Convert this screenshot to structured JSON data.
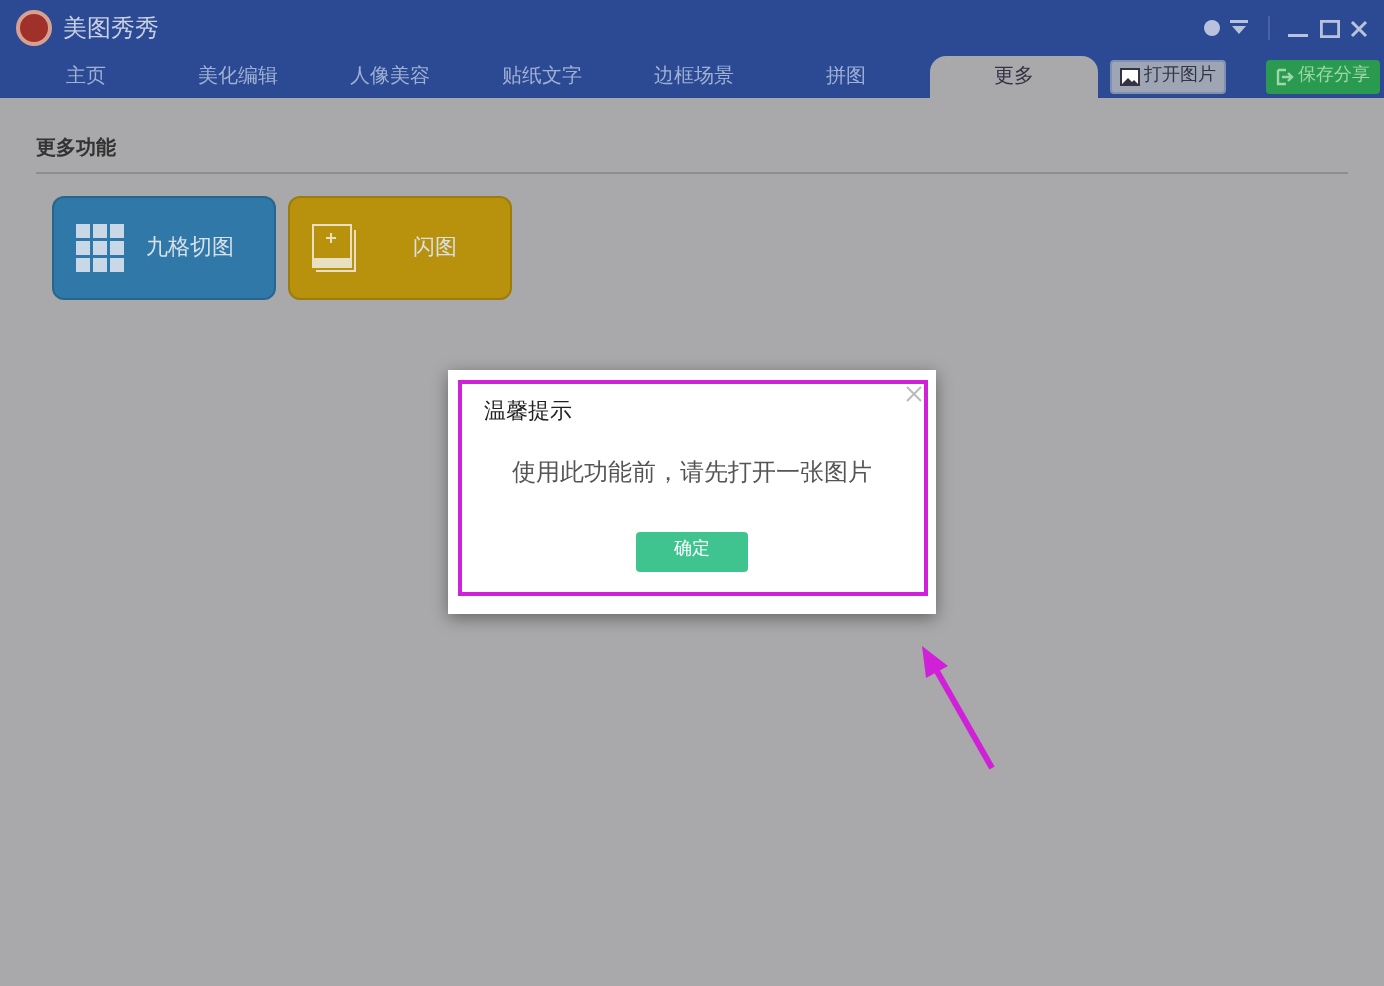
{
  "window": {
    "title": "美图秀秀"
  },
  "tabs": [
    {
      "label": "主页",
      "selected": false
    },
    {
      "label": "美化编辑",
      "selected": false
    },
    {
      "label": "人像美容",
      "selected": false
    },
    {
      "label": "贴纸文字",
      "selected": false
    },
    {
      "label": "边框场景",
      "selected": false
    },
    {
      "label": "拼图",
      "selected": false
    },
    {
      "label": "更多",
      "selected": true
    }
  ],
  "toolbar_buttons": [
    {
      "label": "打开图片",
      "kind": "open"
    },
    {
      "label": "保存分享",
      "kind": "save"
    }
  ],
  "section": {
    "title": "更多功能"
  },
  "features": [
    {
      "label": "九格切图",
      "kind": "grid",
      "color": "#2f78a8"
    },
    {
      "label": "闪图",
      "kind": "frame",
      "color": "#b8920c"
    }
  ],
  "dialog": {
    "title": "温馨提示",
    "message": "使用此功能前，请先打开一张图片",
    "button": "确定"
  }
}
